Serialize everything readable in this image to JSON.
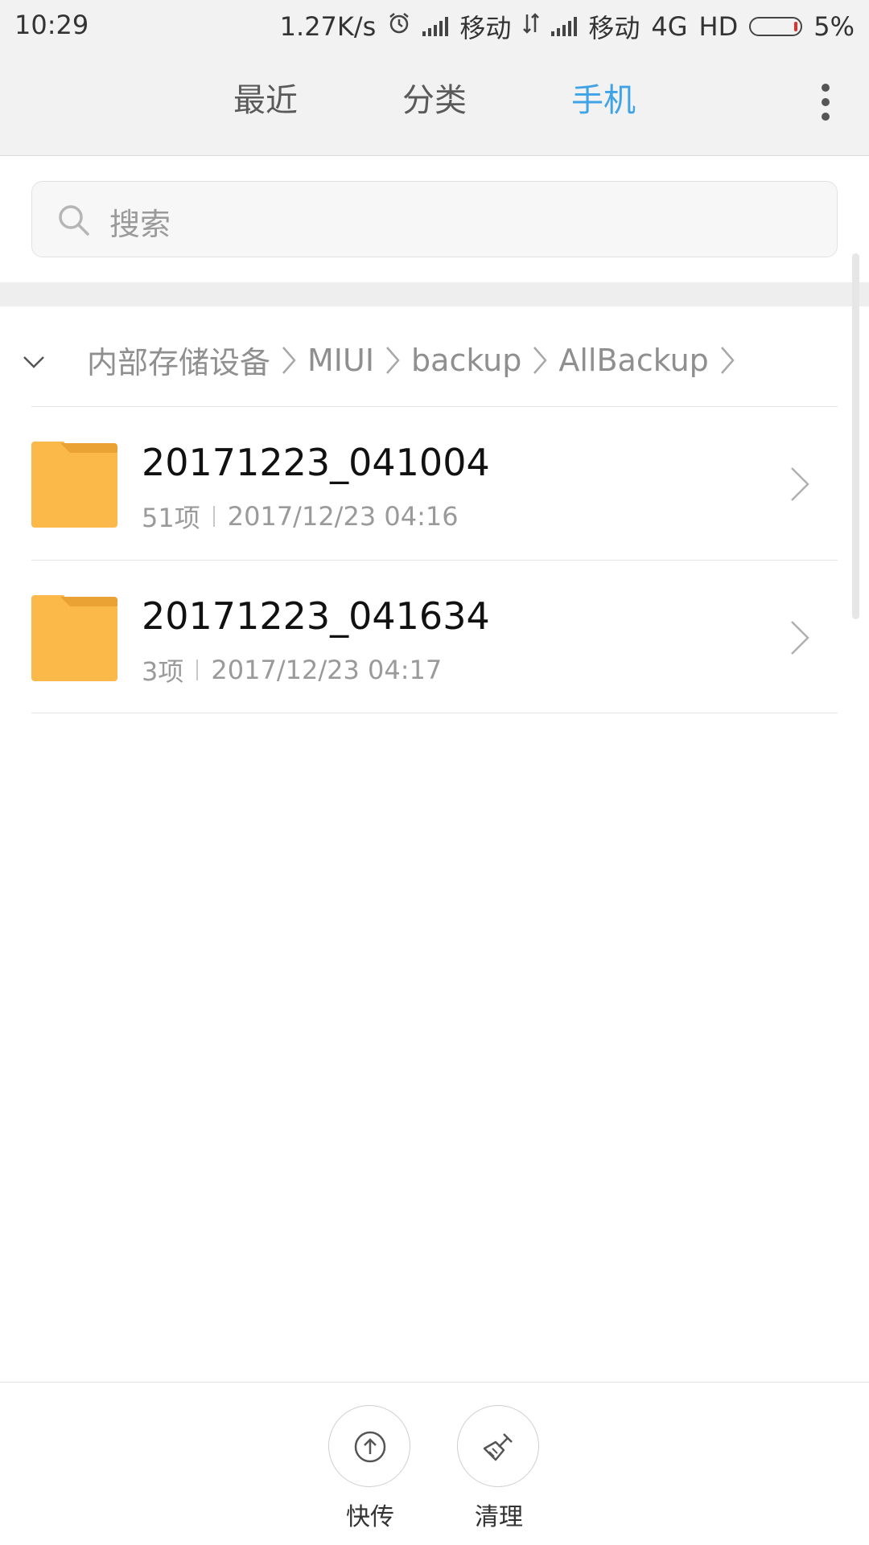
{
  "status_bar": {
    "time": "10:29",
    "speed": "1.27K/s",
    "carrier1": "移动",
    "carrier2": "移动",
    "network": "4G",
    "hd": "HD",
    "battery": "5%",
    "battery_level": 0.05
  },
  "tabs": [
    {
      "label": "最近",
      "active": false
    },
    {
      "label": "分类",
      "active": false
    },
    {
      "label": "手机",
      "active": true
    }
  ],
  "search": {
    "placeholder": "搜索"
  },
  "breadcrumb": [
    "内部存储设备",
    "MIUI",
    "backup",
    "AllBackup"
  ],
  "files": [
    {
      "name": "20171223_041004",
      "count": "51项",
      "date": "2017/12/23 04:16"
    },
    {
      "name": "20171223_041634",
      "count": "3项",
      "date": "2017/12/23 04:17"
    }
  ],
  "bottom_actions": [
    {
      "label": "快传",
      "icon": "upload-icon"
    },
    {
      "label": "清理",
      "icon": "broom-icon"
    }
  ],
  "colors": {
    "accent": "#3fa3e5",
    "folder": "#fbb94a",
    "folder_tab": "#e9a233"
  }
}
